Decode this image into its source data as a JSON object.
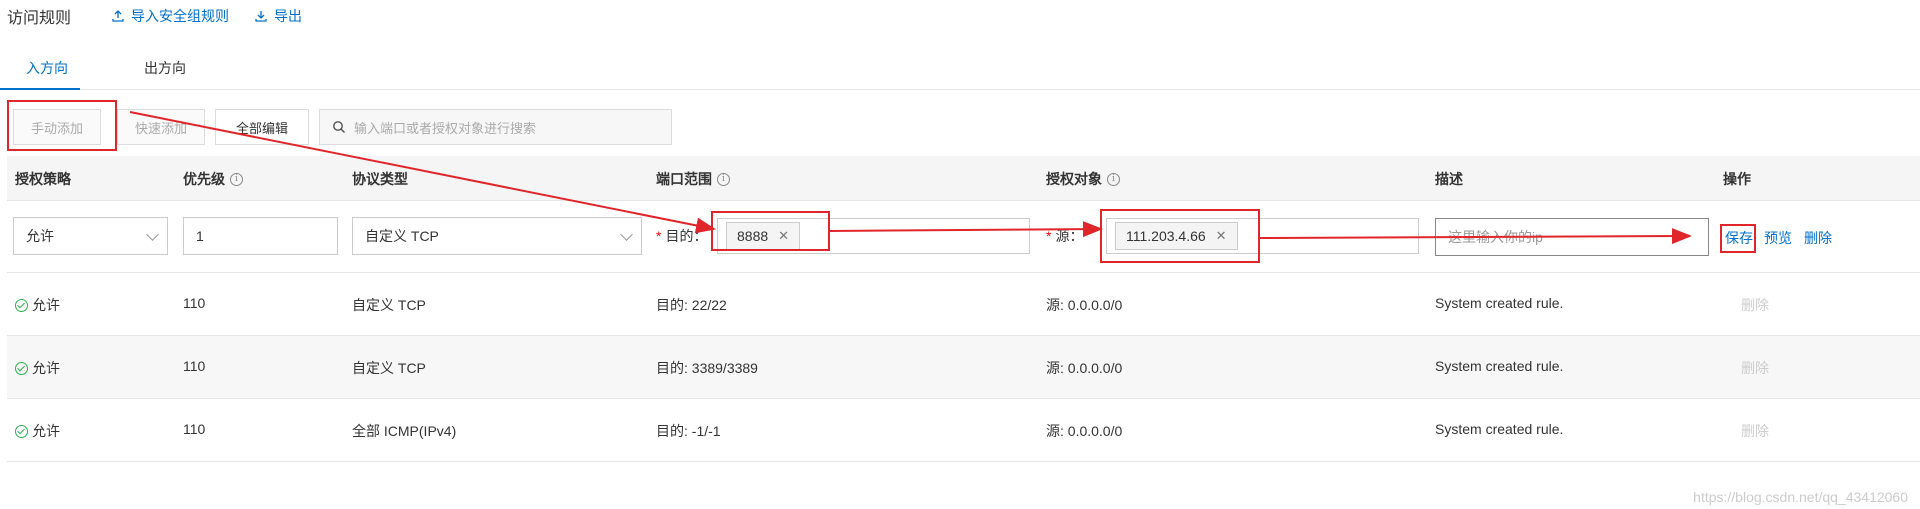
{
  "header": {
    "title": "访问规则",
    "import_label": "导入安全组规则",
    "export_label": "导出"
  },
  "tabs": [
    {
      "label": "入方向",
      "active": true
    },
    {
      "label": "出方向",
      "active": false
    }
  ],
  "toolbar": {
    "manual_add": "手动添加",
    "quick_add": "快速添加",
    "edit_all": "全部编辑",
    "search_placeholder": "输入端口或者授权对象进行搜索"
  },
  "table": {
    "columns": [
      "授权策略",
      "优先级",
      "协议类型",
      "端口范围",
      "授权对象",
      "描述",
      "操作"
    ],
    "edit_row": {
      "policy": "允许",
      "priority": "1",
      "protocol": "自定义 TCP",
      "dest_label": "目的：",
      "port_tag": "8888",
      "source_label": "源：",
      "source_tag": "111.203.4.66",
      "description_placeholder": "这里输入你的ip",
      "save": "保存",
      "preview": "预览",
      "delete": "删除"
    },
    "rows": [
      {
        "policy": "允许",
        "priority": "110",
        "protocol": "自定义 TCP",
        "port": "目的: 22/22",
        "source": "源: 0.0.0.0/0",
        "description": "System created rule.",
        "action": "删除"
      },
      {
        "policy": "允许",
        "priority": "110",
        "protocol": "自定义 TCP",
        "port": "目的: 3389/3389",
        "source": "源: 0.0.0.0/0",
        "description": "System created rule.",
        "action": "删除"
      },
      {
        "policy": "允许",
        "priority": "110",
        "protocol": "全部 ICMP(IPv4)",
        "port": "目的: -1/-1",
        "source": "源: 0.0.0.0/0",
        "description": "System created rule.",
        "action": "删除"
      }
    ]
  },
  "watermark": "https://blog.csdn.net/qq_43412060",
  "colors": {
    "accent": "#0070cc",
    "annotation": "#e0252b",
    "success": "#2bb24c"
  }
}
